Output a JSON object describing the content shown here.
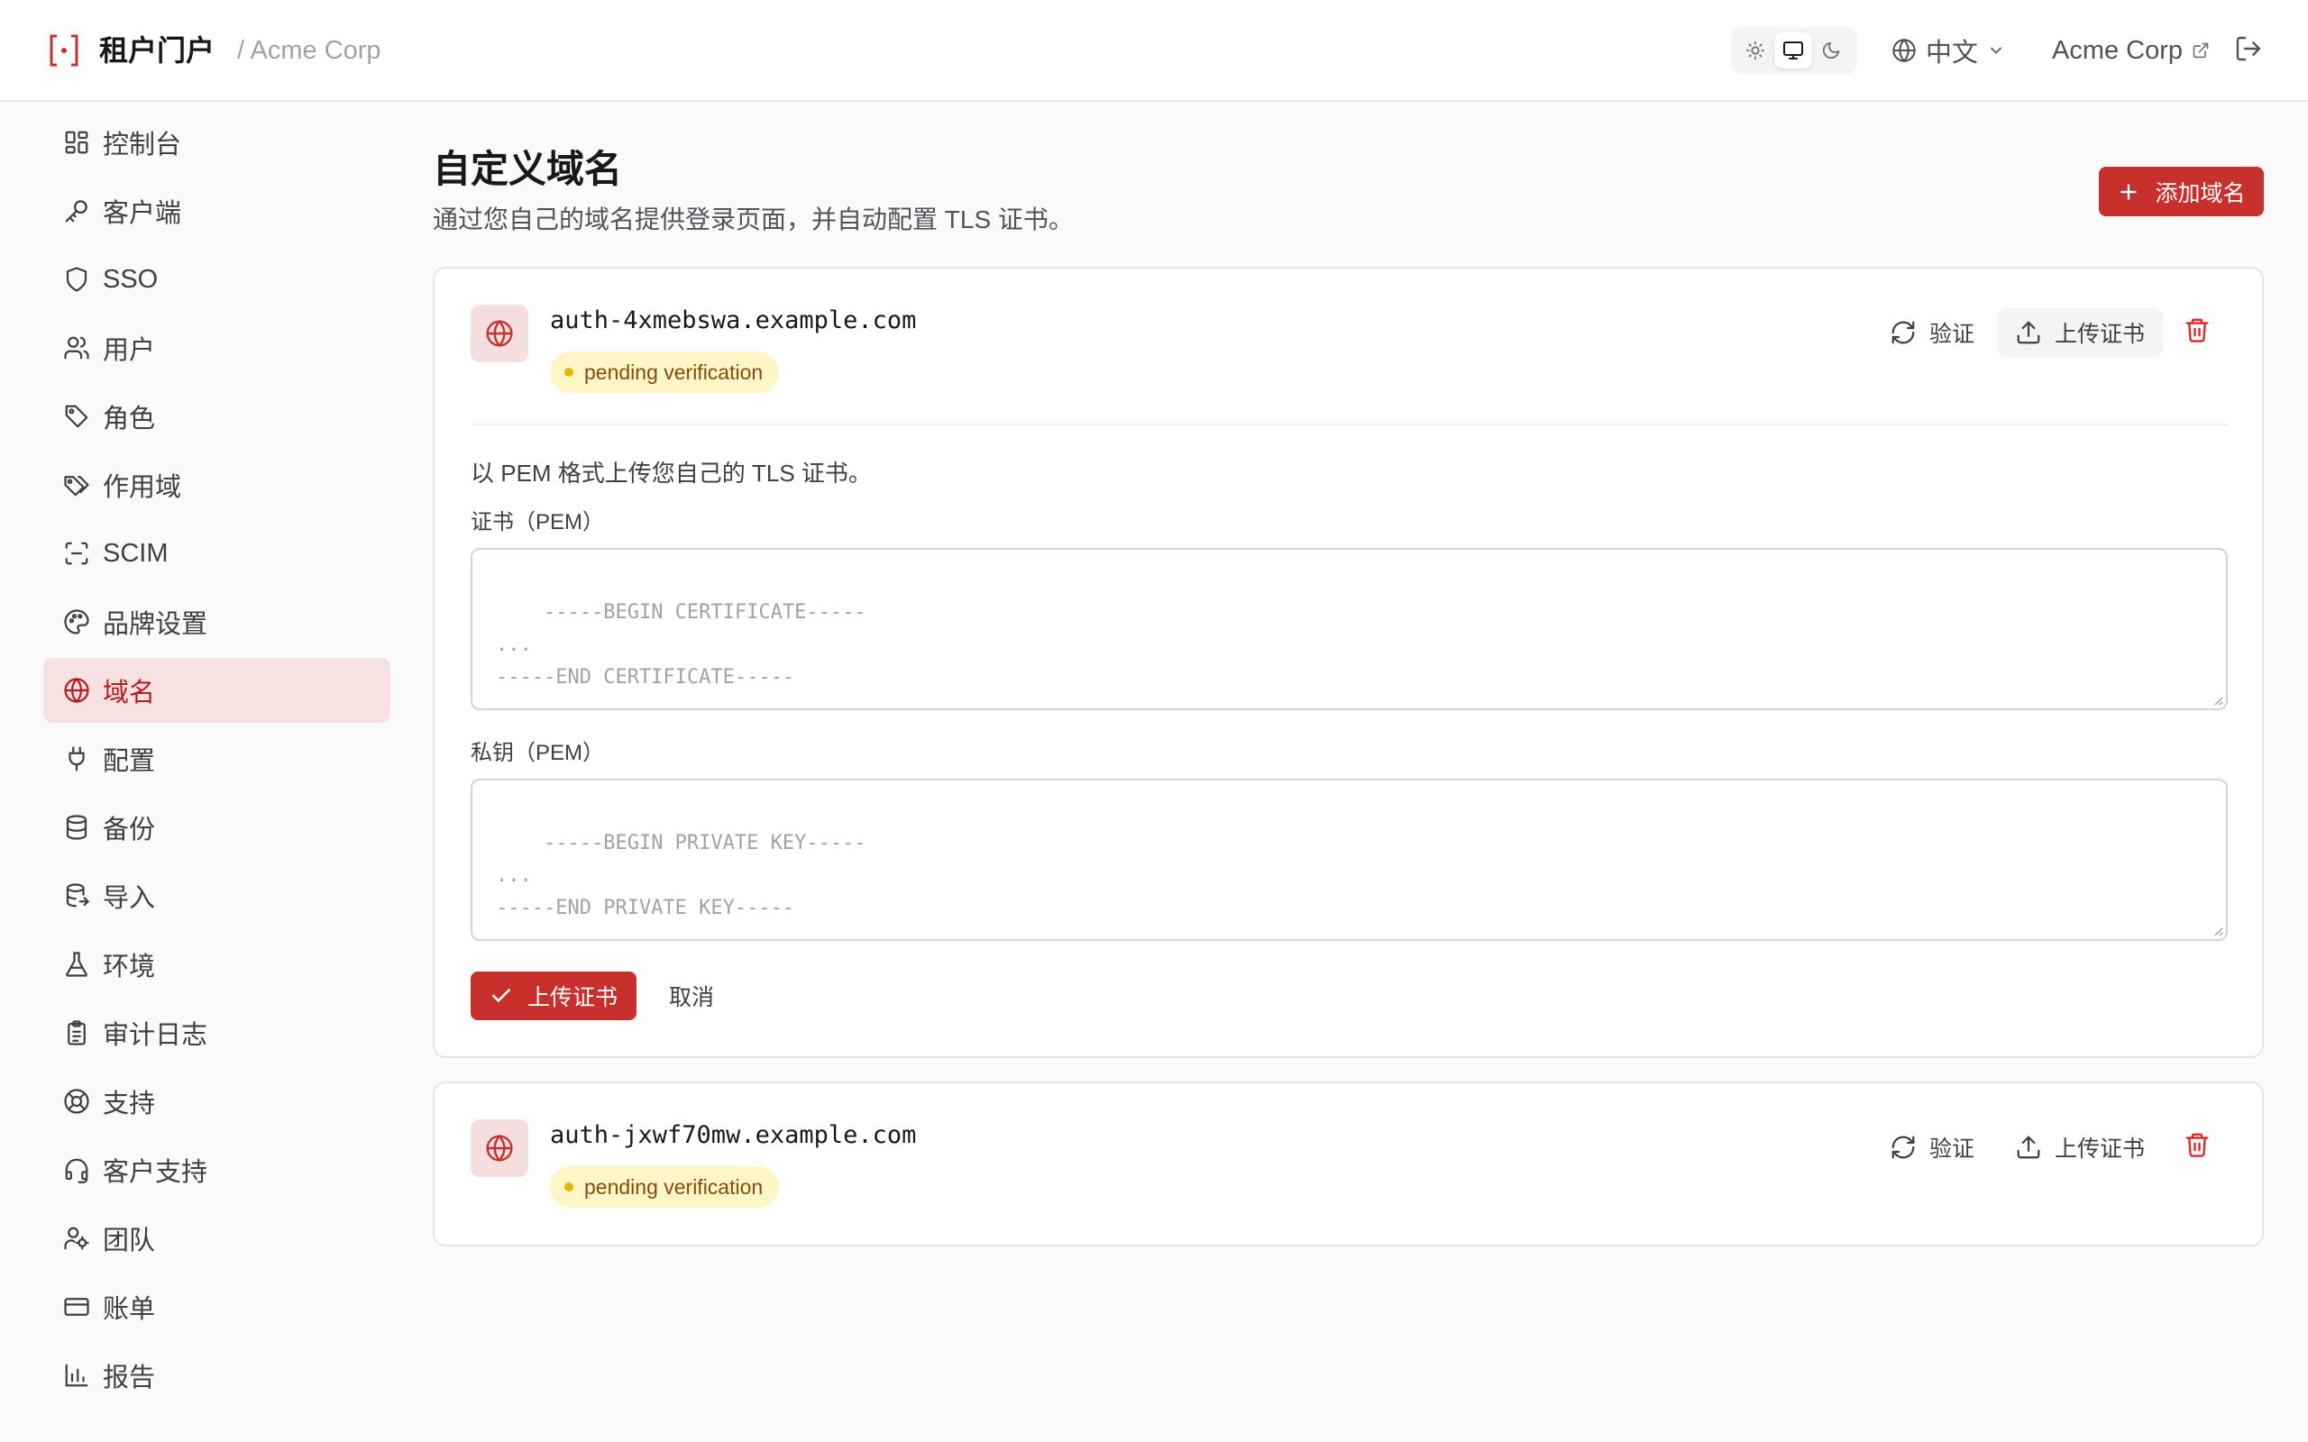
{
  "header": {
    "app_name": "租户门户",
    "breadcrumb": "/ Acme Corp",
    "theme_modes": [
      "sun-icon",
      "monitor-icon",
      "moon-icon"
    ],
    "theme_active": "monitor-icon",
    "language": "中文",
    "tenant_link": "Acme Corp"
  },
  "colors": {
    "brand": "#c8302b",
    "active_nav_bg": "#f7e1e1",
    "badge_bg": "#fef6c7",
    "badge_dot": "#eab308"
  },
  "sidebar": {
    "items": [
      {
        "label": "控制台",
        "icon": "dashboard-icon"
      },
      {
        "label": "客户端",
        "icon": "key-icon"
      },
      {
        "label": "SSO",
        "icon": "shield-icon"
      },
      {
        "label": "用户",
        "icon": "users-icon"
      },
      {
        "label": "角色",
        "icon": "tag-icon"
      },
      {
        "label": "作用域",
        "icon": "tags-icon"
      },
      {
        "label": "SCIM",
        "icon": "scan-icon"
      },
      {
        "label": "品牌设置",
        "icon": "palette-icon"
      },
      {
        "label": "域名",
        "icon": "globe-icon",
        "active": true
      },
      {
        "label": "配置",
        "icon": "plug-icon"
      },
      {
        "label": "备份",
        "icon": "database-icon"
      },
      {
        "label": "导入",
        "icon": "database-import-icon"
      },
      {
        "label": "环境",
        "icon": "flask-icon"
      },
      {
        "label": "审计日志",
        "icon": "clipboard-icon"
      },
      {
        "label": "支持",
        "icon": "lifebuoy-icon"
      },
      {
        "label": "客户支持",
        "icon": "headset-icon"
      },
      {
        "label": "团队",
        "icon": "team-icon"
      },
      {
        "label": "账单",
        "icon": "credit-card-icon"
      },
      {
        "label": "报告",
        "icon": "bar-chart-icon"
      }
    ]
  },
  "page": {
    "title": "自定义域名",
    "description": "通过您自己的域名提供登录页面，并自动配置 TLS 证书。",
    "add_button": "添加域名"
  },
  "domains": [
    {
      "name": "auth-4xmebswa.example.com",
      "status": "pending verification",
      "verify_label": "验证",
      "upload_label": "上传证书",
      "expanded": true,
      "form": {
        "description": "以 PEM 格式上传您自己的 TLS 证书。",
        "cert_label": "证书（PEM）",
        "cert_placeholder": "-----BEGIN CERTIFICATE-----\n...\n-----END CERTIFICATE-----",
        "key_label": "私钥（PEM）",
        "key_placeholder": "-----BEGIN PRIVATE KEY-----\n...\n-----END PRIVATE KEY-----",
        "submit_label": "上传证书",
        "cancel_label": "取消"
      }
    },
    {
      "name": "auth-jxwf70mw.example.com",
      "status": "pending verification",
      "verify_label": "验证",
      "upload_label": "上传证书",
      "expanded": false
    }
  ]
}
